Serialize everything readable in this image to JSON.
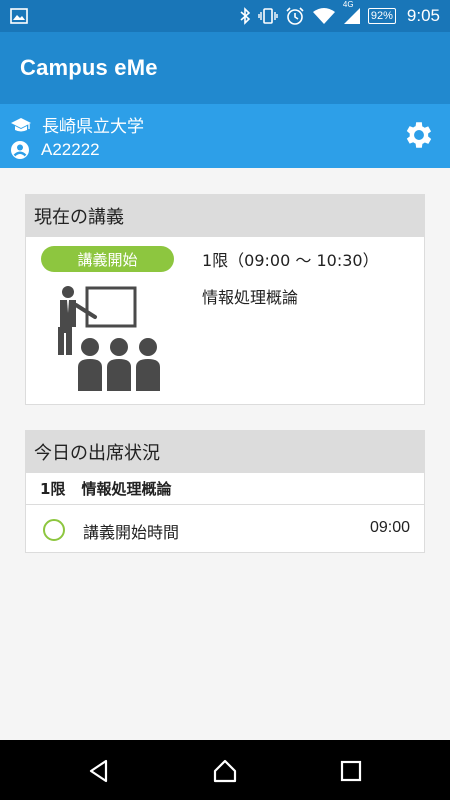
{
  "status_bar": {
    "network": "4G",
    "battery": "92%",
    "time": "9:05",
    "icons": [
      "image-icon",
      "bluetooth-icon",
      "vibrate-icon",
      "alarm-icon",
      "wifi-icon",
      "signal-icon",
      "battery-icon"
    ]
  },
  "app": {
    "title": "Campus eMe"
  },
  "user": {
    "university": "長崎県立大学",
    "student_id": "A22222",
    "icons": [
      "graduation-cap-icon",
      "account-icon",
      "gear-icon"
    ]
  },
  "current_lecture": {
    "header": "現在の講義",
    "badge": "講義開始",
    "period": "1限（09:00 〜 10:30）",
    "subject": "情報処理概論"
  },
  "attendance": {
    "header": "今日の出席状況",
    "period": "1限",
    "subject": "情報処理概論",
    "rows": [
      {
        "label": "講義開始時間",
        "time": "09:00"
      }
    ]
  },
  "colors": {
    "status_bar": "#1976b8",
    "app_bar": "#2189cf",
    "user_bar": "#2d9fe8",
    "accent_green": "#8dc63f"
  },
  "nav": {
    "icons": [
      "back-icon",
      "home-icon",
      "recents-icon"
    ]
  }
}
